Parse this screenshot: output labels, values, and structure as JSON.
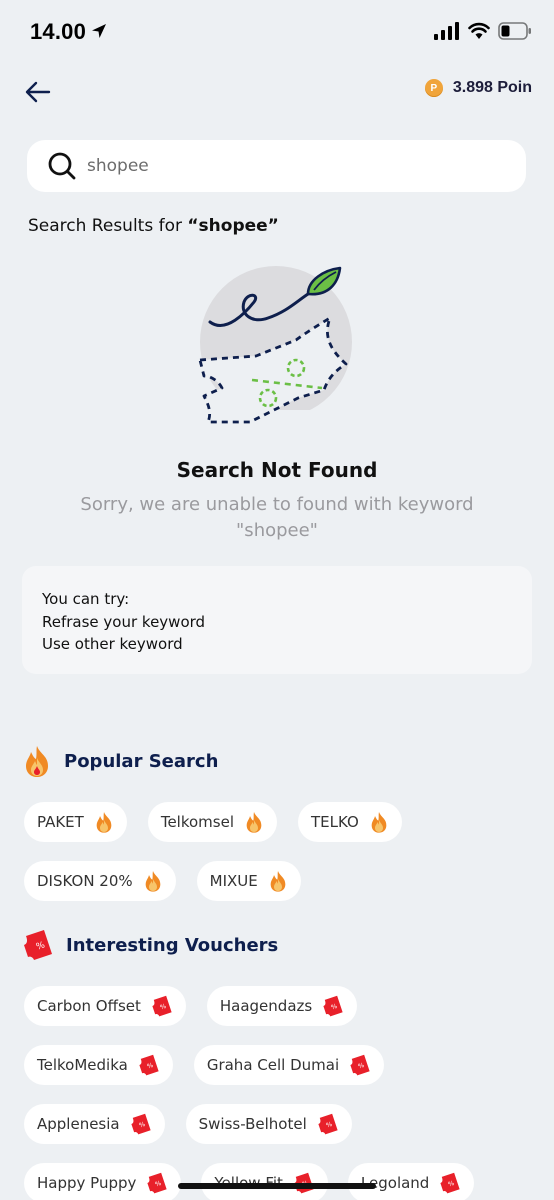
{
  "status_bar": {
    "time": "14.00"
  },
  "header": {
    "points": "3.898 Poin",
    "coin_glyph": "P"
  },
  "search": {
    "value": "shopee"
  },
  "results": {
    "prefix": "Search Results for ",
    "keyword_quoted": "“shopee”"
  },
  "not_found": {
    "title": "Search Not Found",
    "subtitle": "Sorry, we are unable to found with keyword \"shopee\""
  },
  "tips": {
    "lines": [
      "You can try:",
      "Refrase your keyword",
      "Use other keyword"
    ]
  },
  "popular": {
    "title": "Popular Search",
    "icon": "fire-icon",
    "chips": [
      "PAKET",
      "Telkomsel",
      "TELKO",
      "DISKON 20%",
      "MIXUE"
    ]
  },
  "vouchers": {
    "title": "Interesting Vouchers",
    "icon": "voucher-icon",
    "chips": [
      "Carbon Offset",
      "Haagendazs",
      "TelkoMedika",
      "Graha Cell Dumai",
      "Applenesia",
      "Swiss-Belhotel",
      "Happy Puppy",
      "Yellow Fit",
      "Legoland"
    ]
  },
  "colors": {
    "accent_fire": "#f08a24",
    "voucher_red": "#e8202a",
    "leaf_green": "#6bbf45",
    "title_navy": "#0e1f4d"
  }
}
